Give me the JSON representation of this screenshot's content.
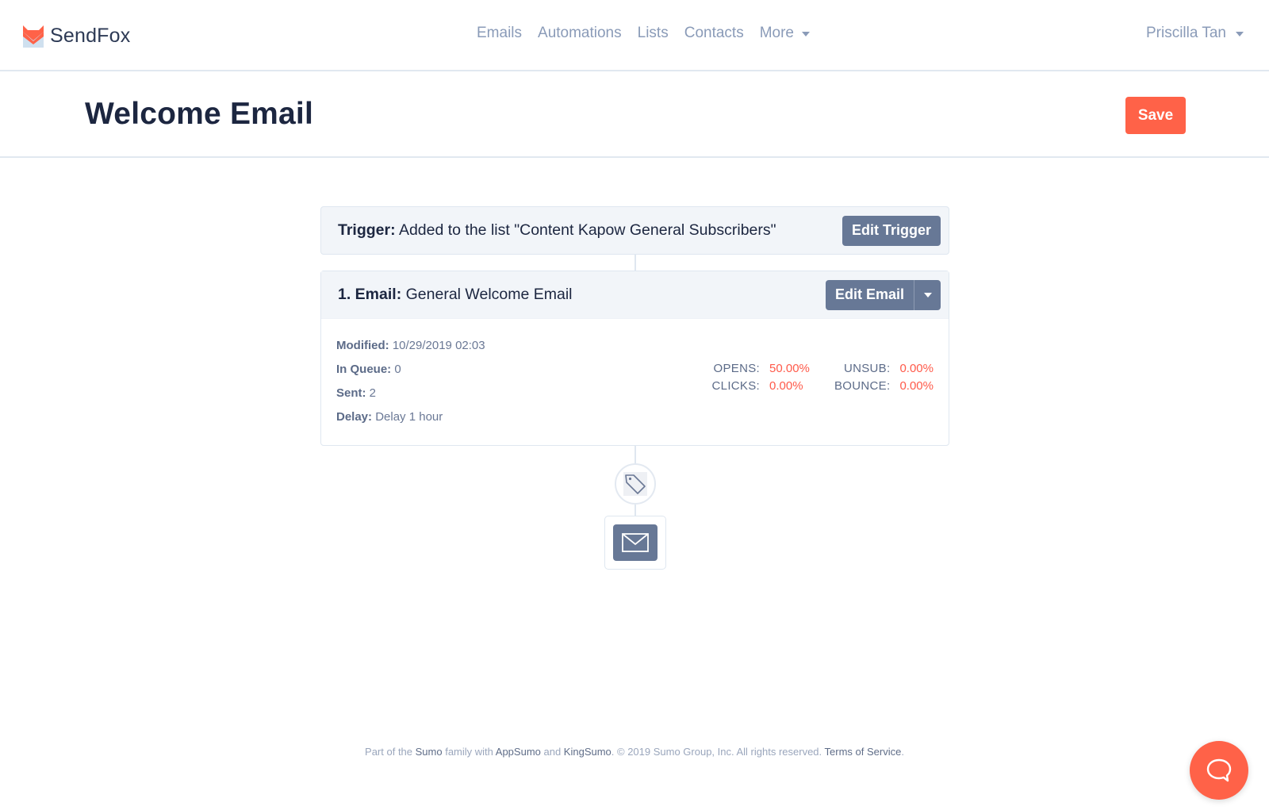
{
  "brand": {
    "name": "SendFox",
    "logo_icon": "fox-envelope-icon",
    "colors": {
      "accent": "#ff6248",
      "envelope": "#cfe0ef"
    }
  },
  "nav": {
    "items": [
      {
        "label": "Emails"
      },
      {
        "label": "Automations"
      },
      {
        "label": "Lists"
      },
      {
        "label": "Contacts"
      },
      {
        "label": "More",
        "has_dropdown": true
      }
    ],
    "user": {
      "name": "Priscilla Tan",
      "has_dropdown": true
    }
  },
  "page": {
    "title": "Welcome Email",
    "save_label": "Save"
  },
  "trigger": {
    "label": "Trigger:",
    "text": "Added to the list \"Content Kapow General Subscribers\"",
    "edit_label": "Edit Trigger"
  },
  "email_step": {
    "label": "1. Email:",
    "name": "General Welcome Email",
    "edit_label": "Edit Email",
    "meta": [
      {
        "label": "Modified:",
        "value": "10/29/2019 02:03"
      },
      {
        "label": "In Queue:",
        "value": "0"
      },
      {
        "label": "Sent:",
        "value": "2"
      },
      {
        "label": "Delay:",
        "value": "Delay 1 hour"
      }
    ],
    "stats": [
      {
        "label": "OPENS:",
        "value": "50.00%"
      },
      {
        "label": "UNSUB:",
        "value": "0.00%"
      },
      {
        "label": "CLICKS:",
        "value": "0.00%"
      },
      {
        "label": "BOUNCE:",
        "value": "0.00%"
      }
    ]
  },
  "flow_nodes": {
    "tag_icon": "tag-icon",
    "add_email_icon": "envelope-icon"
  },
  "footer": {
    "part1": "Part of the ",
    "sumo": "Sumo",
    "part2": " family with ",
    "appsumo": "AppSumo",
    "part3": " and ",
    "kingsumo": "KingSumo",
    "part4": ". © 2019 Sumo Group, Inc. All rights reserved. ",
    "terms": "Terms of Service",
    "part5": "."
  },
  "chat": {
    "icon": "chat-bubble-icon"
  }
}
